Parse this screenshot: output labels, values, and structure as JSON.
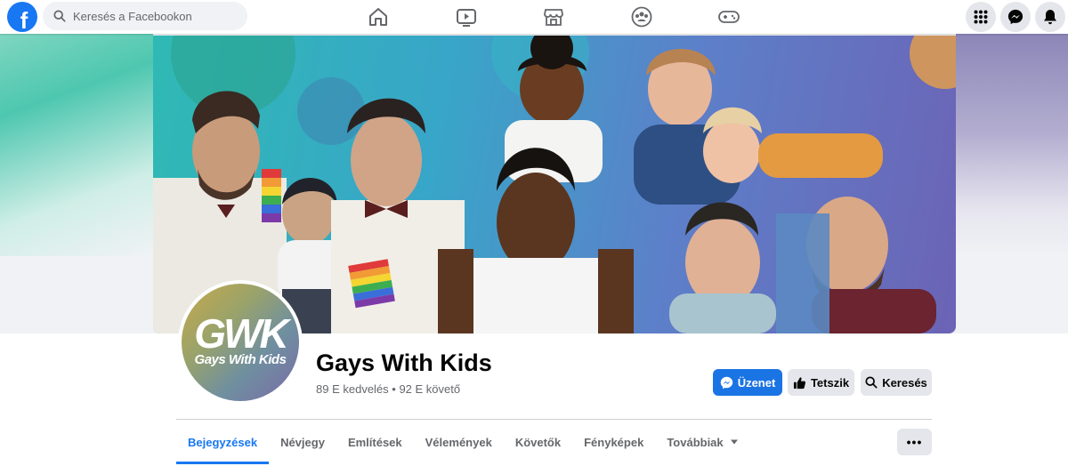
{
  "topbar": {
    "logo_letter": "f",
    "search_placeholder": "Keresés a Facebookon",
    "nav_icons": [
      "home-icon",
      "watch-icon",
      "marketplace-icon",
      "groups-icon",
      "gaming-icon"
    ],
    "right_icons": [
      "menu-grid-icon",
      "messenger-icon",
      "notifications-icon"
    ]
  },
  "cover": {
    "colors": {
      "teal": "#2fb9b4",
      "blue": "#5d7fc9",
      "purple": "#6c63b5"
    }
  },
  "page": {
    "avatar_logo": "GWK",
    "avatar_sub": "Gays With Kids",
    "name": "Gays With Kids",
    "stats": "89 E kedvelés • 92 E követő"
  },
  "actions": {
    "message_label": "Üzenet",
    "like_label": "Tetszik",
    "search_label": "Keresés"
  },
  "tabs": [
    {
      "label": "Bejegyzések",
      "active": true
    },
    {
      "label": "Névjegy"
    },
    {
      "label": "Említések"
    },
    {
      "label": "Vélemények"
    },
    {
      "label": "Követők"
    },
    {
      "label": "Fényképek"
    },
    {
      "label": "Továbbiak"
    }
  ],
  "more_label": "•••",
  "colors": {
    "accent": "#1877f2",
    "button_primary": "#1b74e4",
    "button_gray": "#e4e6eb"
  }
}
